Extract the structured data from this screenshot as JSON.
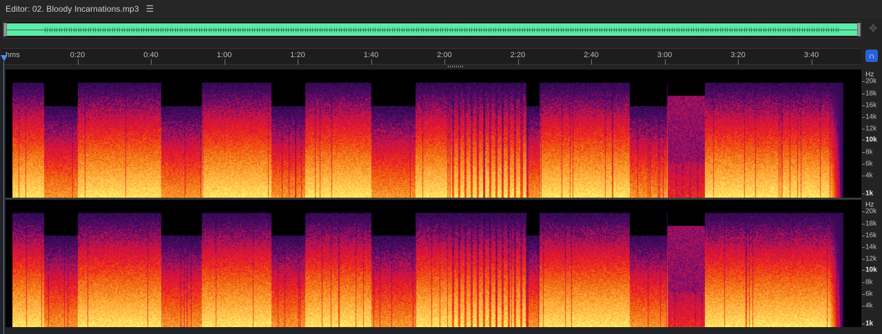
{
  "editor": {
    "title": "Editor: 02. Bloody Incarnations.mp3",
    "menu_icon": "hamburger-menu-icon"
  },
  "timeline": {
    "unit_label": "hms",
    "ticks": [
      "0:20",
      "0:40",
      "1:00",
      "1:20",
      "1:40",
      "2:00",
      "2:20",
      "2:40",
      "3:00",
      "3:20",
      "3:40"
    ]
  },
  "frequency_axis": {
    "unit": "Hz",
    "labels": [
      "20k",
      "18k",
      "16k",
      "14k",
      "12k",
      "10k",
      "8k",
      "6k",
      "4k",
      "1k"
    ]
  },
  "colors": {
    "overview_wave": "#5eeaa8",
    "snap_button": "#2b5fd9",
    "playhead": "#4a8dff"
  },
  "icons": {
    "zoom": "zoom-navigator-icon",
    "snap": "snap-magnet-icon"
  }
}
